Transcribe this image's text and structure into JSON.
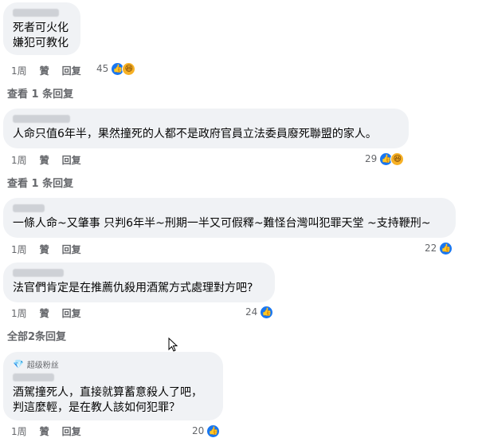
{
  "comments": [
    {
      "text": "死者可火化\n嫌犯可教化",
      "actions": [
        "1周",
        "贊",
        "回复"
      ],
      "reactions": "45"
    },
    {
      "text": "人命只值6年半，果然撞死的人都不是政府官員立法委員廢死聯盟的家人。",
      "actions": [
        "1周",
        "贊",
        "回复"
      ],
      "reactions": "29"
    },
    {
      "text": "一條人命~又肇事 只判6年半~刑期一半又可假釋~難怪台灣叫犯罪天堂 ~支持鞭刑~",
      "actions": [
        "1周",
        "贊",
        "回复"
      ],
      "reactions": "22"
    },
    {
      "text": "法官們肯定是在推薦仇殺用酒駕方式處理對方吧?",
      "actions": [
        "1周",
        "贊",
        "回复"
      ],
      "reactions": "24"
    },
    {
      "badge": "超级粉丝",
      "text": "酒駕撞死人，直接就算蓄意殺人了吧，\n判這麼輕，是在教人該如何犯罪？",
      "actions": [
        "1周",
        "贊",
        "回复"
      ],
      "reactions": "20"
    }
  ],
  "replies": {
    "view1": "查看 1 条回复",
    "view2": "查看 1 条回复",
    "all2": "全部2条回复"
  },
  "icons": {
    "like": "👍",
    "haha": "😆",
    "super_fan": "💎"
  },
  "colors": {
    "bubble": "#f0f2f5",
    "muted": "#65676b",
    "like": "#1877f2"
  }
}
